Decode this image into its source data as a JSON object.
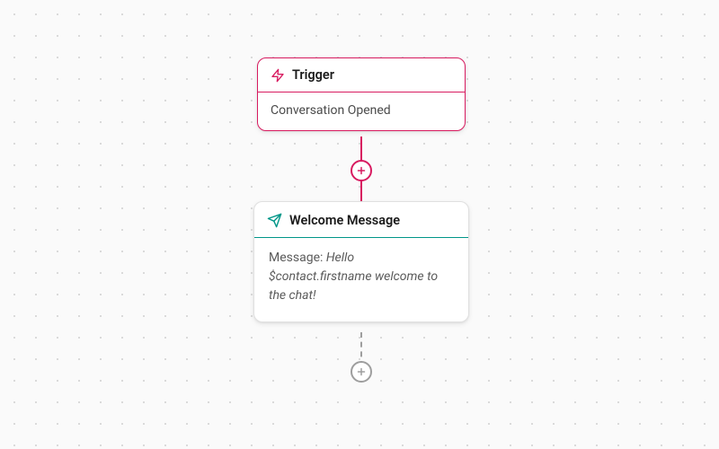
{
  "trigger": {
    "title": "Trigger",
    "event": "Conversation Opened"
  },
  "action": {
    "title": "Welcome Message",
    "label": "Message:",
    "message": "Hello $contact.firstname welcome to the chat!"
  },
  "colors": {
    "trigger": "#d81b60",
    "action": "#009688",
    "muted": "#9e9e9e"
  }
}
